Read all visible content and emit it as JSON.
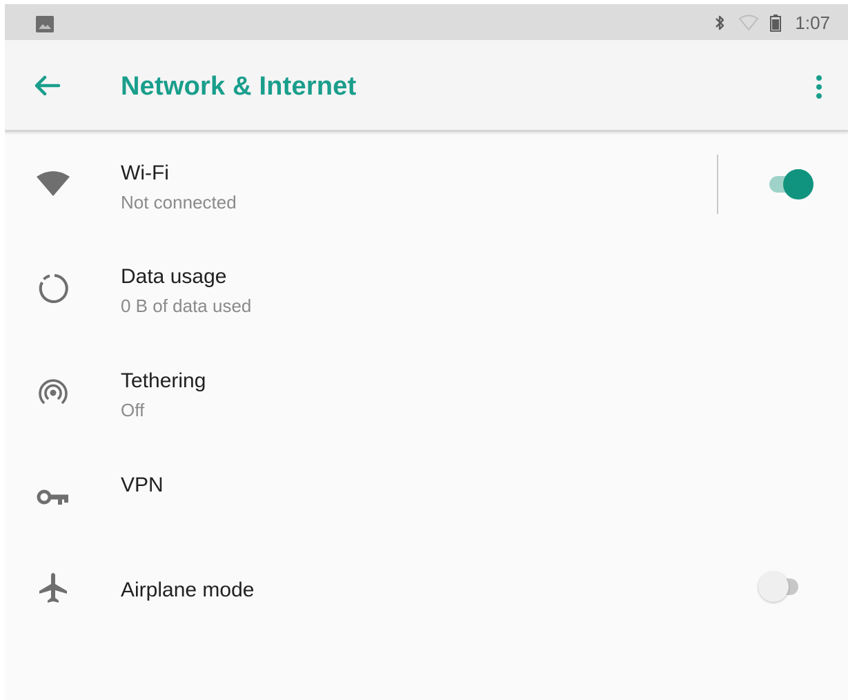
{
  "status_bar": {
    "left_icon": "image-notification-icon",
    "right_icons": [
      "bluetooth-icon",
      "wifi-empty-icon",
      "battery-icon"
    ],
    "time": "1:07"
  },
  "toolbar": {
    "back_icon": "arrow-back-icon",
    "title": "Network & Internet",
    "overflow_icon": "more-vert-icon"
  },
  "settings": {
    "items": [
      {
        "icon": "wifi-icon",
        "title": "Wi-Fi",
        "summary": "Not connected",
        "switch_on": true
      },
      {
        "icon": "data-usage-icon",
        "title": "Data usage",
        "summary": "0 B of data used"
      },
      {
        "icon": "hotspot-icon",
        "title": "Tethering",
        "summary": "Off"
      },
      {
        "icon": "vpn-key-icon",
        "title": "VPN"
      },
      {
        "icon": "airplane-icon",
        "title": "Airplane mode",
        "switch_on": false
      }
    ]
  },
  "colors": {
    "accent": "#1a9e8c",
    "switch_on_thumb": "#11947f",
    "switch_on_track": "#9fd3c9",
    "switch_off_thumb": "#efefef",
    "switch_off_track": "#c7c7c7",
    "status_bar": "#dcdcdc",
    "toolbar": "#f5f5f5",
    "background": "#fafafa",
    "title_text": "#212121",
    "summary_text": "#8a8a8a",
    "icon": "#6f6f6f"
  }
}
